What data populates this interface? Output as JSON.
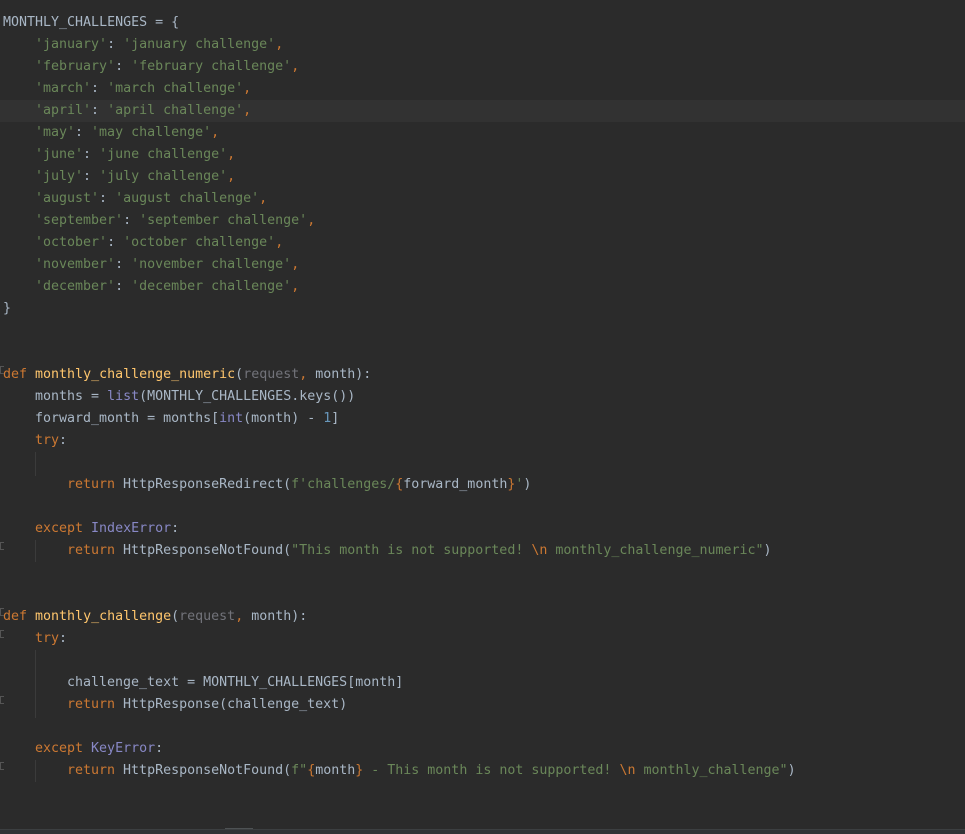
{
  "editor": {
    "lines": [
      {
        "indent": 0,
        "tokens": [
          {
            "t": "MONTHLY_CHALLENGES = {",
            "c": "id"
          }
        ]
      },
      {
        "indent": 1,
        "tokens": [
          {
            "t": "'january'",
            "c": "s"
          },
          {
            "t": ": ",
            "c": "id"
          },
          {
            "t": "'january challenge'",
            "c": "s"
          },
          {
            "t": ",",
            "c": "k"
          }
        ]
      },
      {
        "indent": 1,
        "tokens": [
          {
            "t": "'february'",
            "c": "s"
          },
          {
            "t": ": ",
            "c": "id"
          },
          {
            "t": "'february challenge'",
            "c": "s"
          },
          {
            "t": ",",
            "c": "k"
          }
        ]
      },
      {
        "indent": 1,
        "tokens": [
          {
            "t": "'march'",
            "c": "s"
          },
          {
            "t": ": ",
            "c": "id"
          },
          {
            "t": "'march challenge'",
            "c": "s"
          },
          {
            "t": ",",
            "c": "k"
          }
        ]
      },
      {
        "indent": 1,
        "current": true,
        "tokens": [
          {
            "t": "'april'",
            "c": "s"
          },
          {
            "t": ": ",
            "c": "id"
          },
          {
            "t": "'april challenge'",
            "c": "s"
          },
          {
            "t": ",",
            "c": "k"
          }
        ]
      },
      {
        "indent": 1,
        "tokens": [
          {
            "t": "'may'",
            "c": "s"
          },
          {
            "t": ": ",
            "c": "id"
          },
          {
            "t": "'may challenge'",
            "c": "s"
          },
          {
            "t": ",",
            "c": "k"
          }
        ]
      },
      {
        "indent": 1,
        "tokens": [
          {
            "t": "'june'",
            "c": "s"
          },
          {
            "t": ": ",
            "c": "id"
          },
          {
            "t": "'june challenge'",
            "c": "s"
          },
          {
            "t": ",",
            "c": "k"
          }
        ]
      },
      {
        "indent": 1,
        "tokens": [
          {
            "t": "'july'",
            "c": "s"
          },
          {
            "t": ": ",
            "c": "id"
          },
          {
            "t": "'july challenge'",
            "c": "s"
          },
          {
            "t": ",",
            "c": "k"
          }
        ]
      },
      {
        "indent": 1,
        "tokens": [
          {
            "t": "'august'",
            "c": "s"
          },
          {
            "t": ": ",
            "c": "id"
          },
          {
            "t": "'august challenge'",
            "c": "s"
          },
          {
            "t": ",",
            "c": "k"
          }
        ]
      },
      {
        "indent": 1,
        "tokens": [
          {
            "t": "'september'",
            "c": "s"
          },
          {
            "t": ": ",
            "c": "id"
          },
          {
            "t": "'september challenge'",
            "c": "s"
          },
          {
            "t": ",",
            "c": "k"
          }
        ]
      },
      {
        "indent": 1,
        "tokens": [
          {
            "t": "'october'",
            "c": "s"
          },
          {
            "t": ": ",
            "c": "id"
          },
          {
            "t": "'october challenge'",
            "c": "s"
          },
          {
            "t": ",",
            "c": "k"
          }
        ]
      },
      {
        "indent": 1,
        "tokens": [
          {
            "t": "'november'",
            "c": "s"
          },
          {
            "t": ": ",
            "c": "id"
          },
          {
            "t": "'november challenge'",
            "c": "s"
          },
          {
            "t": ",",
            "c": "k"
          }
        ]
      },
      {
        "indent": 1,
        "tokens": [
          {
            "t": "'december'",
            "c": "s"
          },
          {
            "t": ": ",
            "c": "id"
          },
          {
            "t": "'december challenge'",
            "c": "s"
          },
          {
            "t": ",",
            "c": "k"
          }
        ]
      },
      {
        "indent": 0,
        "tokens": [
          {
            "t": "}",
            "c": "id"
          }
        ]
      },
      {
        "indent": 0,
        "tokens": []
      },
      {
        "indent": 0,
        "tokens": []
      },
      {
        "indent": 0,
        "tokens": [
          {
            "t": "def ",
            "c": "k"
          },
          {
            "t": "monthly_challenge_numeric",
            "c": "fn"
          },
          {
            "t": "(",
            "c": "id"
          },
          {
            "t": "request",
            "c": "p"
          },
          {
            "t": ", ",
            "c": "k"
          },
          {
            "t": "month",
            "c": "id"
          },
          {
            "t": "):",
            "c": "id"
          }
        ]
      },
      {
        "indent": 1,
        "tokens": [
          {
            "t": "months = ",
            "c": "id"
          },
          {
            "t": "list",
            "c": "bi"
          },
          {
            "t": "(MONTHLY_CHALLENGES.keys())",
            "c": "id"
          }
        ]
      },
      {
        "indent": 1,
        "tokens": [
          {
            "t": "forward_month = months[",
            "c": "id"
          },
          {
            "t": "int",
            "c": "bi"
          },
          {
            "t": "(month) - ",
            "c": "id"
          },
          {
            "t": "1",
            "c": "num"
          },
          {
            "t": "]",
            "c": "id"
          }
        ]
      },
      {
        "indent": 1,
        "tokens": [
          {
            "t": "try",
            "c": "k"
          },
          {
            "t": ":",
            "c": "id"
          }
        ]
      },
      {
        "indent": 0,
        "tokens": []
      },
      {
        "indent": 2,
        "tokens": [
          {
            "t": "return ",
            "c": "k"
          },
          {
            "t": "HttpResponseRedirect(",
            "c": "id"
          },
          {
            "t": "f'challenges/",
            "c": "s"
          },
          {
            "t": "{",
            "c": "k"
          },
          {
            "t": "forward_month",
            "c": "id"
          },
          {
            "t": "}",
            "c": "k"
          },
          {
            "t": "'",
            "c": "s"
          },
          {
            "t": ")",
            "c": "id"
          }
        ]
      },
      {
        "indent": 0,
        "tokens": []
      },
      {
        "indent": 1,
        "tokens": [
          {
            "t": "except ",
            "c": "k"
          },
          {
            "t": "IndexError",
            "c": "bi"
          },
          {
            "t": ":",
            "c": "id"
          }
        ]
      },
      {
        "indent": 2,
        "tokens": [
          {
            "t": "return ",
            "c": "k"
          },
          {
            "t": "HttpResponseNotFound(",
            "c": "id"
          },
          {
            "t": "\"This month is not supported! ",
            "c": "s"
          },
          {
            "t": "\\n",
            "c": "esc"
          },
          {
            "t": " monthly_challenge_numeric\"",
            "c": "s"
          },
          {
            "t": ")",
            "c": "id"
          }
        ]
      },
      {
        "indent": 0,
        "tokens": []
      },
      {
        "indent": 0,
        "tokens": []
      },
      {
        "indent": 0,
        "tokens": [
          {
            "t": "def ",
            "c": "k"
          },
          {
            "t": "monthly_challenge",
            "c": "fn"
          },
          {
            "t": "(",
            "c": "id"
          },
          {
            "t": "request",
            "c": "p"
          },
          {
            "t": ", ",
            "c": "k"
          },
          {
            "t": "month",
            "c": "id"
          },
          {
            "t": "):",
            "c": "id"
          }
        ]
      },
      {
        "indent": 1,
        "tokens": [
          {
            "t": "try",
            "c": "k"
          },
          {
            "t": ":",
            "c": "id"
          }
        ]
      },
      {
        "indent": 0,
        "tokens": []
      },
      {
        "indent": 2,
        "tokens": [
          {
            "t": "challenge_text = MONTHLY_CHALLENGES[month]",
            "c": "id"
          }
        ]
      },
      {
        "indent": 2,
        "tokens": [
          {
            "t": "return ",
            "c": "k"
          },
          {
            "t": "HttpResponse(challenge_text)",
            "c": "id"
          }
        ]
      },
      {
        "indent": 0,
        "tokens": []
      },
      {
        "indent": 1,
        "tokens": [
          {
            "t": "except ",
            "c": "k"
          },
          {
            "t": "KeyError",
            "c": "bi"
          },
          {
            "t": ":",
            "c": "id"
          }
        ]
      },
      {
        "indent": 2,
        "tokens": [
          {
            "t": "return ",
            "c": "k"
          },
          {
            "t": "HttpResponseNotFound(",
            "c": "id"
          },
          {
            "t": "f\"",
            "c": "s"
          },
          {
            "t": "{",
            "c": "k"
          },
          {
            "t": "month",
            "c": "id"
          },
          {
            "t": "}",
            "c": "k"
          },
          {
            "t": " - This month is not supported! ",
            "c": "s"
          },
          {
            "t": "\\n",
            "c": "esc"
          },
          {
            "t": " monthly_challenge\"",
            "c": "s"
          },
          {
            "t": ")",
            "c": "id"
          }
        ]
      }
    ]
  },
  "colors": {
    "background": "#2b2b2b",
    "current_line": "#323232",
    "keyword": "#cc7832",
    "string": "#6a8759",
    "function": "#ffc66d",
    "builtin": "#8888c6",
    "number": "#6897bb",
    "param": "#72737a",
    "text": "#a9b7c6"
  }
}
